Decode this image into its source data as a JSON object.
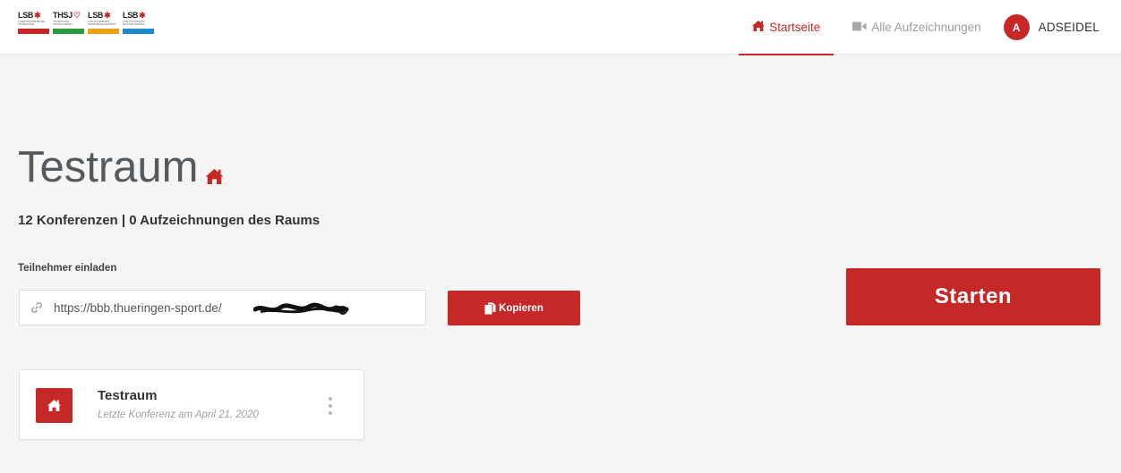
{
  "header": {
    "logos": [
      {
        "text": "LSB",
        "sub": "LANDESSPORTBUND THÜRINGEN",
        "bar_color": "#c62828",
        "bar_text": "Wir im Sport"
      },
      {
        "text": "THSJ",
        "sub": "THÜRINGER SPORTJUGEND",
        "bar_color": "#2e9a3e",
        "bar_text": "Jugend im Sport"
      },
      {
        "text": "LSB",
        "sub": "LSB THÜRINGEN SPORTMANAGEMENT",
        "bar_color": "#e8a317",
        "bar_text": "Wir im Sport"
      },
      {
        "text": "LSB",
        "sub": "LSB THÜRINGEN BILDUNGSWERK",
        "bar_color": "#1e88c8",
        "bar_text": "Wir im Sport"
      }
    ],
    "nav": {
      "home_label": "Startseite",
      "home_icon": "home-icon",
      "recordings_label": "Alle Aufzeichnungen",
      "recordings_icon": "video-camera-icon"
    },
    "user": {
      "avatar_initial": "A",
      "name": "ADSEIDEL"
    }
  },
  "room": {
    "title": "Testraum",
    "title_icon": "home-icon",
    "stats": "12 Konferenzen | 0 Aufzeichnungen des Raums",
    "invite_label": "Teilnehmer einladen",
    "invite_link": "https://bbb.thueringen-sport.de/",
    "link_icon": "link-icon",
    "copy_label": "Kopieren",
    "copy_icon": "copy-icon",
    "start_label": "Starten"
  },
  "room_list": [
    {
      "name": "Testraum",
      "last_conference": "Letzte Konferenz am April 21, 2020",
      "icon": "home-icon",
      "menu_icon": "vertical-ellipsis-icon"
    }
  ],
  "colors": {
    "accent": "#c62828",
    "background": "#f5f5f5",
    "muted_text": "#9e9e9e"
  }
}
